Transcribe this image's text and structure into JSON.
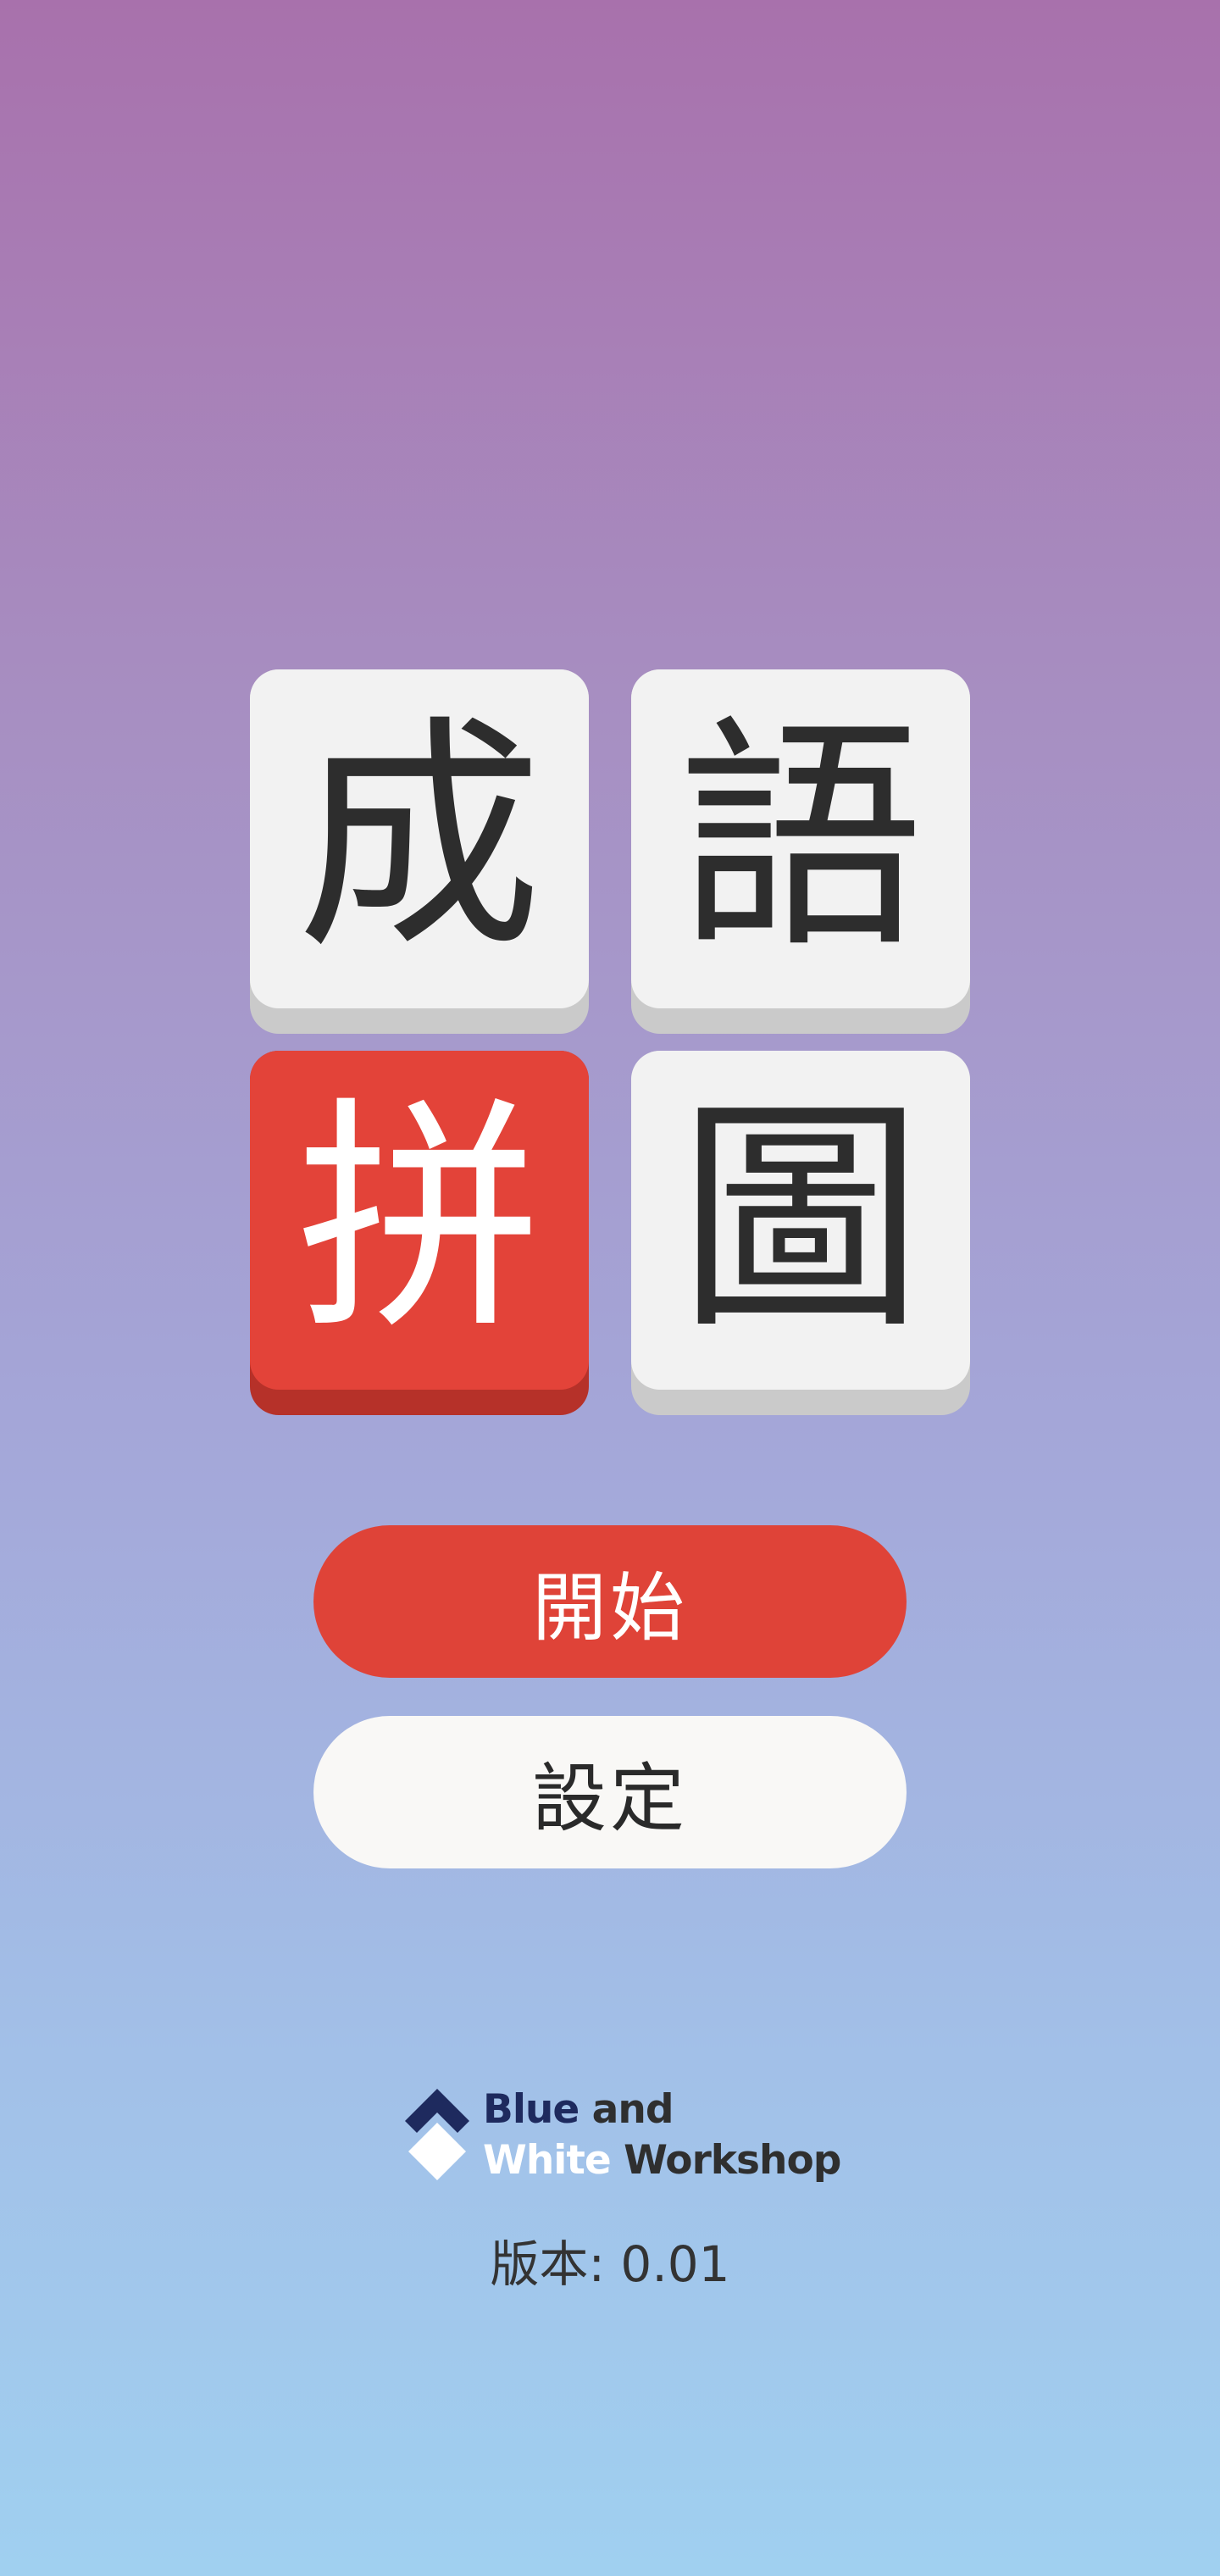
{
  "title_tiles": [
    {
      "char": "成",
      "style": "white"
    },
    {
      "char": "語",
      "style": "white"
    },
    {
      "char": "拼",
      "style": "red"
    },
    {
      "char": "圖",
      "style": "white"
    }
  ],
  "menu": {
    "start_label": "開始",
    "settings_label": "設定"
  },
  "brand": {
    "line1_word1": "Blue",
    "line1_word2": "and",
    "line2_word1": "White",
    "line2_word2": "Workshop",
    "icon": "stacked-diamonds-logo-icon"
  },
  "version": {
    "text": "版本: 0.01"
  },
  "colors": {
    "accent_red": "#e34339",
    "tile_white": "#f2f2f2",
    "brand_navy": "#1e2a5e",
    "background_top": "#a871ac",
    "background_bottom": "#a0d0f0"
  }
}
